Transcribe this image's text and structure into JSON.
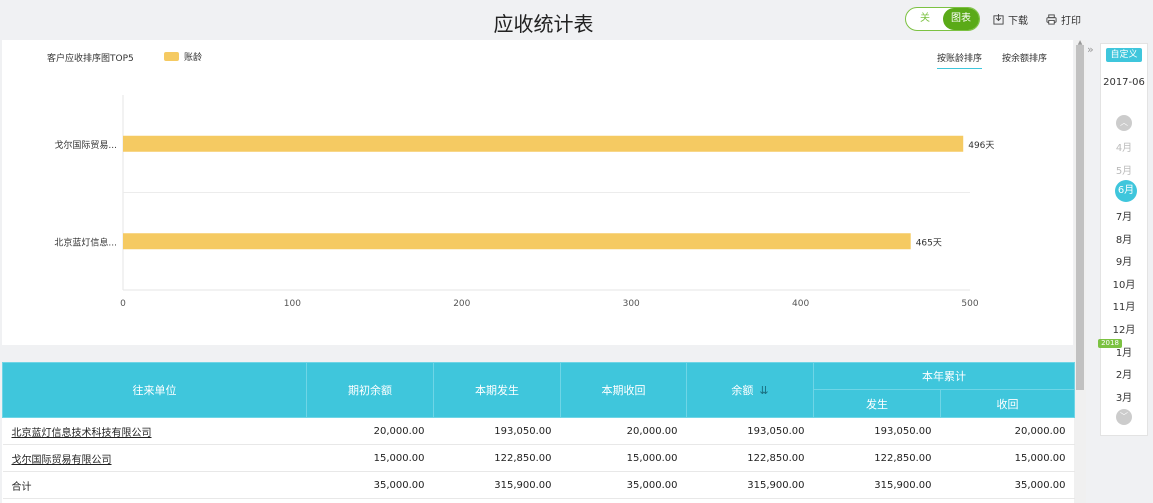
{
  "header": {
    "title": "应收统计表",
    "toggle_off": "关",
    "toggle_on": "图表",
    "download": "下载",
    "print": "打印"
  },
  "chart_panel": {
    "title": "客户应收排序图TOP5",
    "legend": "账龄",
    "sort_tabs": [
      "按账龄排序",
      "按余额排序"
    ]
  },
  "chart_data": {
    "type": "bar",
    "orientation": "horizontal",
    "categories": [
      "戈尔国际贸易...",
      "北京蓝灯信息..."
    ],
    "series": [
      {
        "name": "账龄",
        "values": [
          496,
          465
        ],
        "color": "#f5ca62"
      }
    ],
    "data_labels": [
      "496天",
      "465天"
    ],
    "xlim": [
      0,
      500
    ],
    "xticks": [
      0,
      100,
      200,
      300,
      400,
      500
    ],
    "legend_position": "top-left",
    "grid": true
  },
  "table": {
    "headers": {
      "unit": "往来单位",
      "opening": "期初余额",
      "incurred": "本期发生",
      "recovered": "本期收回",
      "balance": "余额",
      "ytd": "本年累计",
      "ytd_incurred": "发生",
      "ytd_recovered": "收回"
    },
    "rows": [
      [
        "北京蓝灯信息技术科技有限公司",
        "20,000.00",
        "193,050.00",
        "20,000.00",
        "193,050.00",
        "193,050.00",
        "20,000.00"
      ],
      [
        "戈尔国际贸易有限公司",
        "15,000.00",
        "122,850.00",
        "15,000.00",
        "122,850.00",
        "122,850.00",
        "15,000.00"
      ],
      [
        "合计",
        "35,000.00",
        "315,900.00",
        "35,000.00",
        "315,900.00",
        "315,900.00",
        "35,000.00"
      ]
    ]
  },
  "sidebar": {
    "custom": "自定义",
    "current_period": "2017-06",
    "year_tag": "2018",
    "months": [
      "4月",
      "5月",
      "6月",
      "7月",
      "8月",
      "9月",
      "10月",
      "11月",
      "12月",
      "1月",
      "2月",
      "3月"
    ]
  },
  "colors": {
    "accent": "#3fc6dc",
    "bar": "#f5ca62",
    "toggle": "#7cc242"
  }
}
